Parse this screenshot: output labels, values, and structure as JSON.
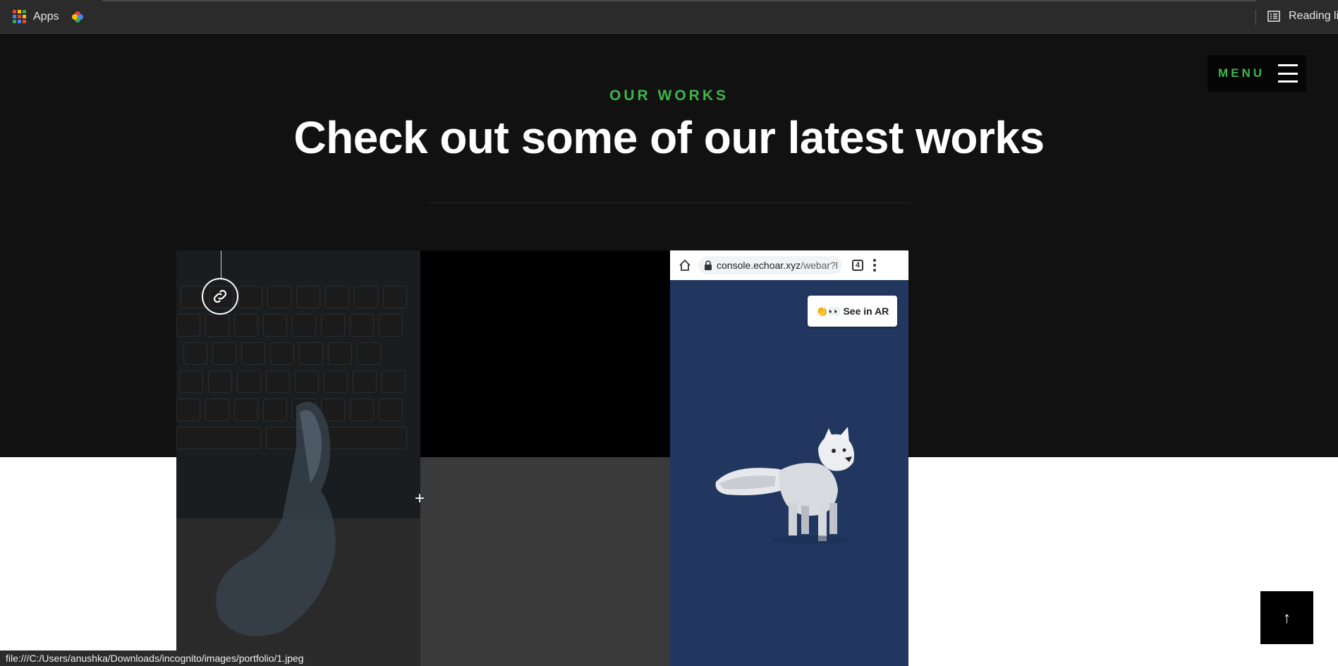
{
  "browser": {
    "apps_label": "Apps",
    "reading_list_label": "Reading list",
    "status_url": "file:///C:/Users/anushka/Downloads/incognito/images/portfolio/1.jpeg"
  },
  "nav": {
    "menu_label": "MENU"
  },
  "section": {
    "eyebrow": "OUR WORKS",
    "title": "Check out some of our latest works"
  },
  "portfolio": {
    "phone": {
      "url_host": "console.echoar.xyz",
      "url_path": "/webar?l",
      "tab_count": "4",
      "ar_button": "👏👀 See in AR"
    },
    "plus_glyph": "+"
  },
  "scroll_top_glyph": "↑",
  "colors": {
    "accent_green": "#3fb54a",
    "hero_bg": "#111111",
    "phone_bg": "#21375f"
  }
}
